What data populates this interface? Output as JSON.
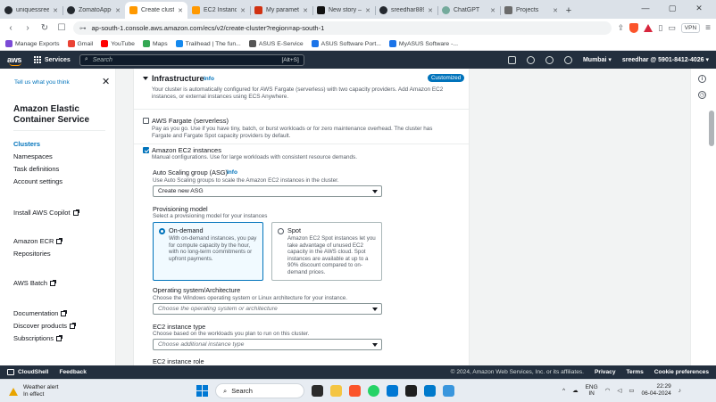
{
  "browser": {
    "tabs": [
      {
        "title": "uniquessreedhar/",
        "color": "#24292f"
      },
      {
        "title": "ZomatoApp-Clon",
        "color": "#24292f"
      },
      {
        "title": "Create cluster",
        "color": "#ff9900",
        "active": true
      },
      {
        "title": "EC2 Instance Co",
        "color": "#ff9900"
      },
      {
        "title": "My parameters -",
        "color": "#d13212"
      },
      {
        "title": "New story – Med",
        "color": "#111111"
      },
      {
        "title": "sreedhar8897/se",
        "color": "#24292f"
      },
      {
        "title": "ChatGPT",
        "color": "#74aa9c"
      },
      {
        "title": "Projects",
        "color": "#6b6b6b"
      }
    ],
    "url": "ap-south-1.console.aws.amazon.com/ecs/v2/create-cluster?region=ap-south-1",
    "vpn_label": "VPN",
    "bookmarks": [
      {
        "label": "Manage Exports",
        "color": "#7b4bd6"
      },
      {
        "label": "Gmail",
        "color": "#ea4335"
      },
      {
        "label": "YouTube",
        "color": "#ff0000"
      },
      {
        "label": "Maps",
        "color": "#34a853"
      },
      {
        "label": "Trailhead | The fun...",
        "color": "#1589ee"
      },
      {
        "label": "ASUS E-Service",
        "color": "#555555"
      },
      {
        "label": "ASUS Software Port...",
        "color": "#1a73e8"
      },
      {
        "label": "MyASUS Software -...",
        "color": "#1a73e8"
      }
    ]
  },
  "aws_nav": {
    "logo": "aws",
    "services": "Services",
    "search_placeholder": "Search",
    "shortcut": "[Alt+S]",
    "region": "Mumbai ▾",
    "account": "sreedhar @ 5901-8412-4026 ▾"
  },
  "sidebar": {
    "tell_us": "Tell us what you think",
    "title": "Amazon Elastic Container Service",
    "items": [
      {
        "label": "Clusters",
        "active": true
      },
      {
        "label": "Namespaces"
      },
      {
        "label": "Task definitions"
      },
      {
        "label": "Account settings"
      },
      {
        "label": "Install AWS Copilot",
        "external": true
      },
      {
        "label": "Amazon ECR",
        "external": true
      },
      {
        "label": "Repositories"
      },
      {
        "label": "AWS Batch",
        "external": true
      },
      {
        "label": "Documentation",
        "external": true
      },
      {
        "label": "Discover products",
        "external": true
      },
      {
        "label": "Subscriptions",
        "external": true
      }
    ]
  },
  "infra": {
    "title": "Infrastructure",
    "info": "Info",
    "badge": "Customized",
    "description": "Your cluster is automatically configured for AWS Fargate (serverless) with two capacity providers. Add Amazon EC2 instances, or external instances using ECS Anywhere.",
    "fargate": {
      "title": "AWS Fargate (serverless)",
      "desc": "Pay as you go. Use if you have tiny, batch, or burst workloads or for zero maintenance overhead. The cluster has Fargate and Fargate Spot capacity providers by default."
    },
    "ec2": {
      "title": "Amazon EC2 instances",
      "desc": "Manual configurations. Use for large workloads with consistent resource demands."
    },
    "asg": {
      "label": "Auto Scaling group (ASG)",
      "info": "Info",
      "desc": "Use Auto Scaling groups to scale the Amazon EC2 instances in the cluster.",
      "value": "Create new ASG"
    },
    "provisioning": {
      "label": "Provisioning model",
      "desc": "Select a provisioning model for your instances",
      "ondemand_title": "On-demand",
      "ondemand_desc": "With on-demand instances, you pay for compute capacity by the hour, with no long-term commitments or upfront payments.",
      "spot_title": "Spot",
      "spot_desc": "Amazon EC2 Spot instances let you take advantage of unused EC2 capacity in the AWS cloud. Spot instances are available at up to a 90% discount compared to on-demand prices."
    },
    "os": {
      "label": "Operating system/Architecture",
      "desc": "Choose the Windows operating system or Linux architecture for your instance.",
      "placeholder": "Choose the operating system or architecture"
    },
    "instance_type": {
      "label": "EC2 instance type",
      "desc": "Choose based on the workloads you plan to run on this cluster.",
      "placeholder": "Choose additional instance type"
    },
    "instance_role": {
      "label": "EC2 instance role"
    }
  },
  "footer": {
    "cloudshell": "CloudShell",
    "feedback": "Feedback",
    "copyright": "© 2024, Amazon Web Services, Inc. or its affiliates.",
    "privacy": "Privacy",
    "terms": "Terms",
    "cookies": "Cookie preferences"
  },
  "taskbar": {
    "weather_title": "Weather alert",
    "weather_sub": "In effect",
    "search": "Search",
    "lang1": "ENG",
    "lang2": "IN",
    "time": "22:29",
    "date": "06-04-2024"
  },
  "colors": {
    "aws_dark": "#232f3e",
    "aws_orange": "#ff9900",
    "link_blue": "#0073bb"
  }
}
